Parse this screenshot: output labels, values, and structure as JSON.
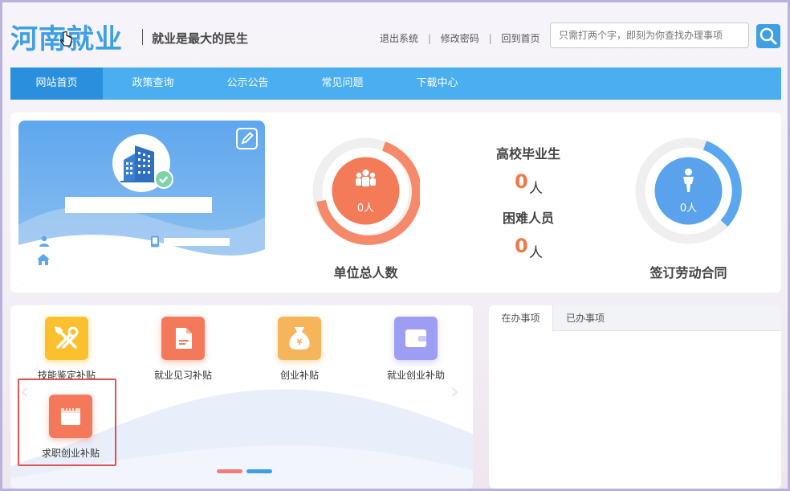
{
  "header": {
    "logo": "河南就业",
    "slogan": "就业是最大的民生",
    "links": [
      "退出系统",
      "修改密码",
      "回到首页"
    ],
    "search_placeholder": "只需打两个字，即刻为你查找办理事项"
  },
  "nav": {
    "items": [
      "网站首页",
      "政策查询",
      "公示公告",
      "常见问题",
      "下载中心"
    ],
    "active_index": 0
  },
  "stats": {
    "total_employees": {
      "label": "单位总人数",
      "value": "0人"
    },
    "graduates": {
      "label": "高校毕业生",
      "value": "0",
      "unit": "人"
    },
    "hardship": {
      "label": "困难人员",
      "value": "0",
      "unit": "人"
    },
    "contracts": {
      "label": "签订劳动合同",
      "value": "0人"
    }
  },
  "subsidies": [
    {
      "label": "技能鉴定补贴",
      "icon": "tools-icon",
      "color": "#fbc02d"
    },
    {
      "label": "就业见习补贴",
      "icon": "document-icon",
      "color": "#f4795b"
    },
    {
      "label": "创业补贴",
      "icon": "money-bag-icon",
      "color": "#f7b55b"
    },
    {
      "label": "就业创业补助",
      "icon": "wallet-icon",
      "color": "#9d9ef3"
    },
    {
      "label": "求职创业补贴",
      "icon": "calendar-icon",
      "color": "#f4795b"
    }
  ],
  "tasks": {
    "tabs": [
      "在办事项",
      "已办事项"
    ],
    "active_index": 0
  },
  "colors": {
    "brand": "#3d9fe4",
    "nav": "#4aaef0",
    "nav_active": "#2a8fdd",
    "accent": "#f4774c"
  }
}
